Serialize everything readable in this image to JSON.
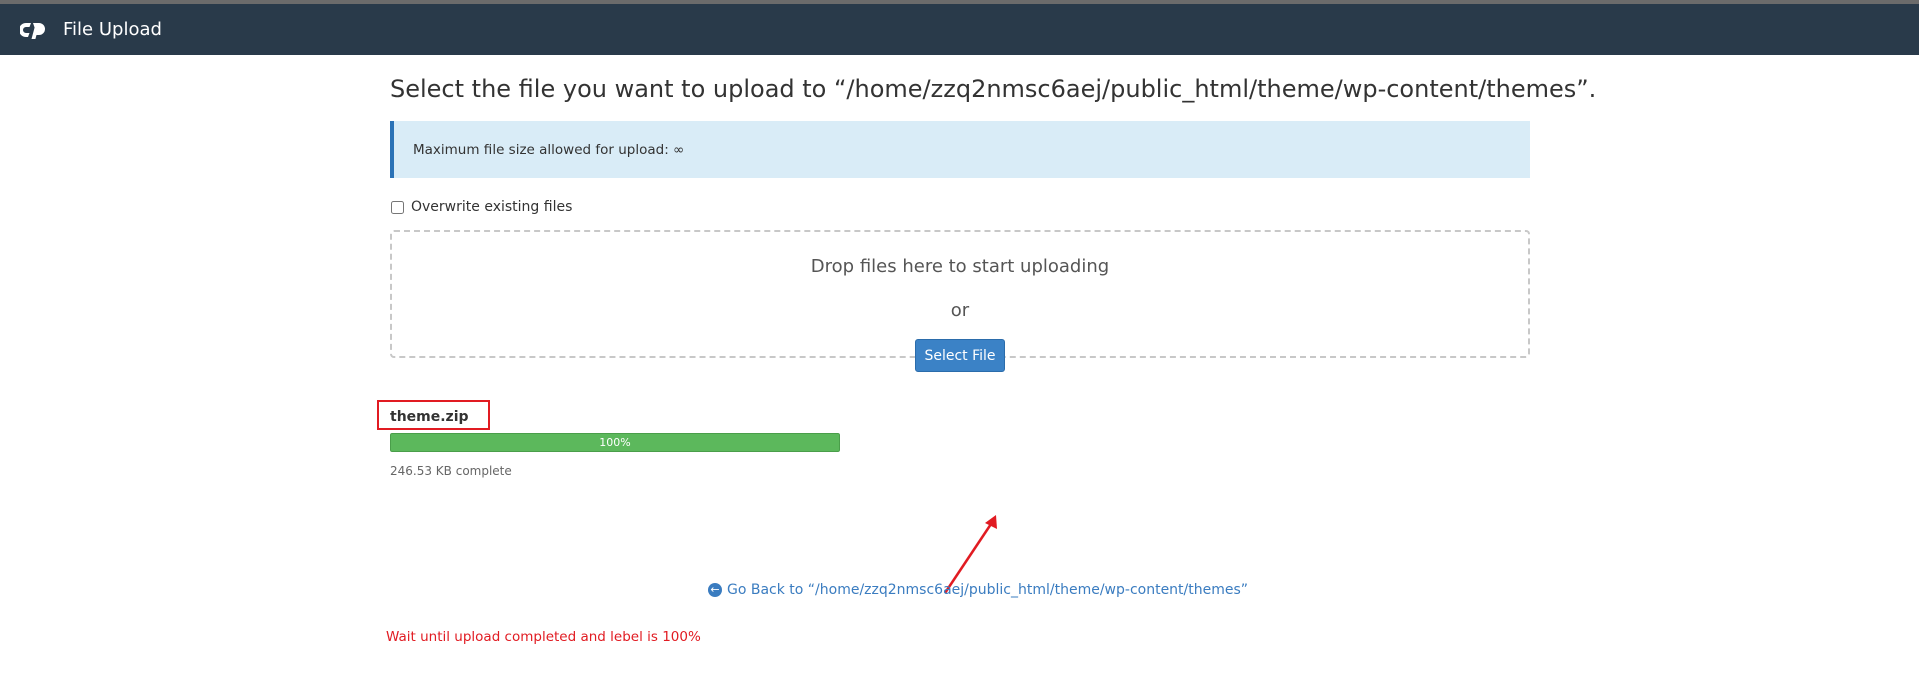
{
  "header": {
    "title": "File Upload",
    "logo_icon": "cpanel-logo-icon"
  },
  "main": {
    "title": "Select the file you want to upload to “/home/zzq2nmsc6aej/public_html/theme/wp-content/themes”.",
    "alert_text": "Maximum file size allowed for upload: ∞",
    "overwrite_label": "Overwrite existing files",
    "overwrite_checked": false,
    "dropzone": {
      "drop_text": "Drop files here to start uploading",
      "or_text": "or",
      "select_button": "Select File"
    },
    "upload": {
      "file_name": "theme.zip",
      "progress_label": "100%",
      "progress_fraction": 1.0,
      "status_text": "246.53 KB complete"
    },
    "go_back": {
      "icon": "arrow-circle-left-icon",
      "label": "Go Back to “/home/zzq2nmsc6aej/public_html/theme/wp-content/themes”"
    }
  },
  "annotation": {
    "text": "Wait until upload completed and lebel is 100%",
    "color": "#e11b22"
  },
  "colors": {
    "header_bg": "#293a4a",
    "alert_bg": "#d9ecf7",
    "alert_border": "#2b72b6",
    "button_bg": "#3b82c6",
    "progress_fill": "#5cb85c",
    "link": "#3a7cc0",
    "annotation_red": "#e11b22"
  }
}
